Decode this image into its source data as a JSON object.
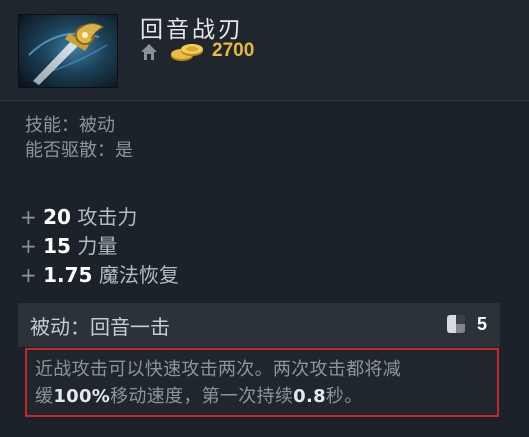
{
  "item": {
    "name": "回音战刃",
    "icon": "echo-sabre-icon",
    "shop_icon": "home-shop-icon",
    "gold_icon": "gold-coins-icon",
    "cost": "2700"
  },
  "properties": {
    "ability_type": "技能：被动",
    "dispellable": "能否驱散：是"
  },
  "stats": [
    {
      "plus": "+",
      "value": "20",
      "label": "攻击力"
    },
    {
      "plus": "+",
      "value": "15",
      "label": "力量"
    },
    {
      "plus": "+",
      "value": "1.75",
      "label": "魔法恢复"
    }
  ],
  "ability": {
    "title": "被动：回音一击",
    "cooldown_icon": "cooldown-icon",
    "cooldown": "5",
    "desc_line1": "近战攻击可以快速攻击两次。两次攻击都将减",
    "desc_prefix": "缓",
    "desc_slow": "100%",
    "desc_mid": "移动速度，第一次持续",
    "desc_duration": "0.8",
    "desc_suffix": "秒。"
  },
  "colors": {
    "gold": "#e8b940",
    "highlight_border": "#c8252b",
    "background": "#1c2229"
  }
}
